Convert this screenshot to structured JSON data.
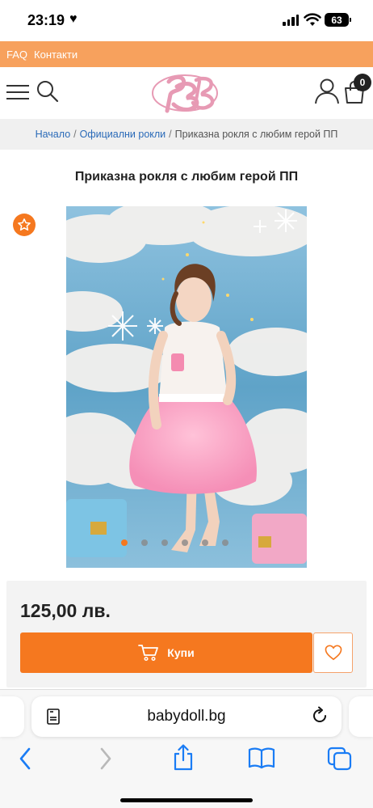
{
  "status_bar": {
    "time": "23:19",
    "battery": "63"
  },
  "top_links": [
    "FAQ",
    "Контакти"
  ],
  "header": {
    "cart_count": "0"
  },
  "breadcrumb": {
    "items": [
      "Начало",
      "Официални рокли",
      "Приказна рокля с любим герой ПП"
    ],
    "separator": "/"
  },
  "product": {
    "title": "Приказна рокля с любим герой ПП",
    "price": "125,00 лв.",
    "buy_label": "Купи",
    "gallery_dots": 6,
    "active_dot": 0
  },
  "browser": {
    "url": "babydoll.bg"
  },
  "colors": {
    "accent": "#f5781f",
    "top_bar": "#f7a15d",
    "link": "#2a6ab8",
    "logo_pink": "#e79ab4"
  },
  "icons": [
    "heart-icon",
    "wifi-icon",
    "hamburger-icon",
    "search-icon",
    "logo",
    "user-icon",
    "cart-icon",
    "star-icon",
    "cart-buy-icon",
    "heart-outline-icon",
    "reader-icon",
    "reload-icon",
    "back-icon",
    "forward-icon",
    "share-icon",
    "bookmarks-icon",
    "tabs-icon"
  ]
}
